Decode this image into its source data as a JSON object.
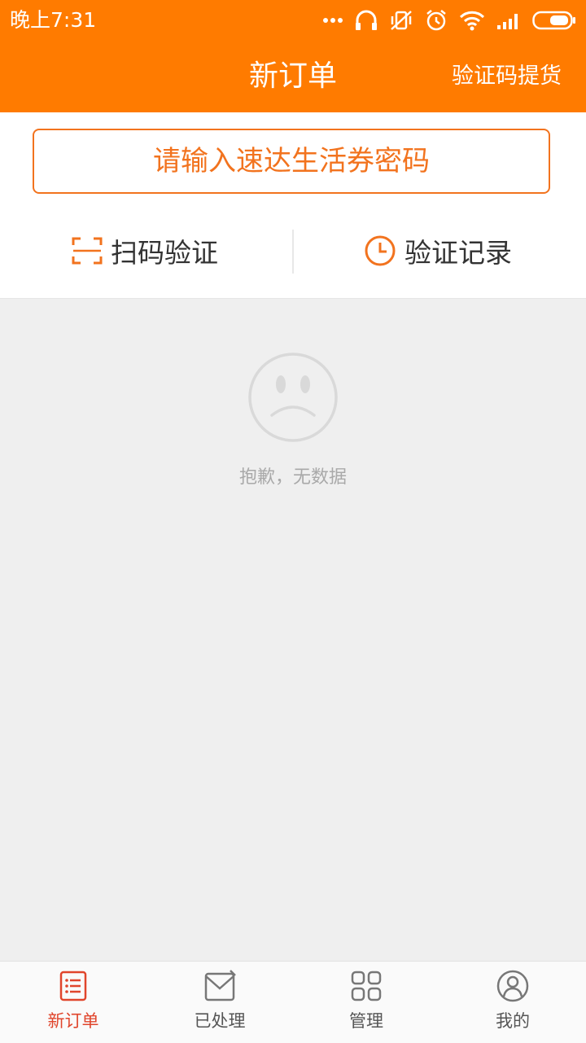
{
  "status_bar": {
    "time": "晚上7:31",
    "icons": [
      "more-dots-icon",
      "headphones-icon",
      "vibrate-off-icon",
      "alarm-icon",
      "wifi-icon",
      "signal-icon",
      "battery-icon"
    ]
  },
  "header": {
    "title": "新订单",
    "pickup_link": "验证码提货"
  },
  "code_entry": {
    "placeholder": "请输入速达生活券密码"
  },
  "actions": {
    "scan_label": "扫码验证",
    "history_label": "验证记录"
  },
  "empty_state": {
    "message": "抱歉，无数据"
  },
  "bottom_nav": {
    "items": [
      {
        "label": "新订单",
        "icon": "order-list-icon",
        "active": true
      },
      {
        "label": "已处理",
        "icon": "processed-mail-icon",
        "active": false
      },
      {
        "label": "管理",
        "icon": "grid-icon",
        "active": false
      },
      {
        "label": "我的",
        "icon": "user-icon",
        "active": false
      }
    ]
  },
  "colors": {
    "accent": "#ff7b00",
    "input_border": "#f2731e",
    "nav_active": "#e0452c",
    "background": "#efefef"
  }
}
